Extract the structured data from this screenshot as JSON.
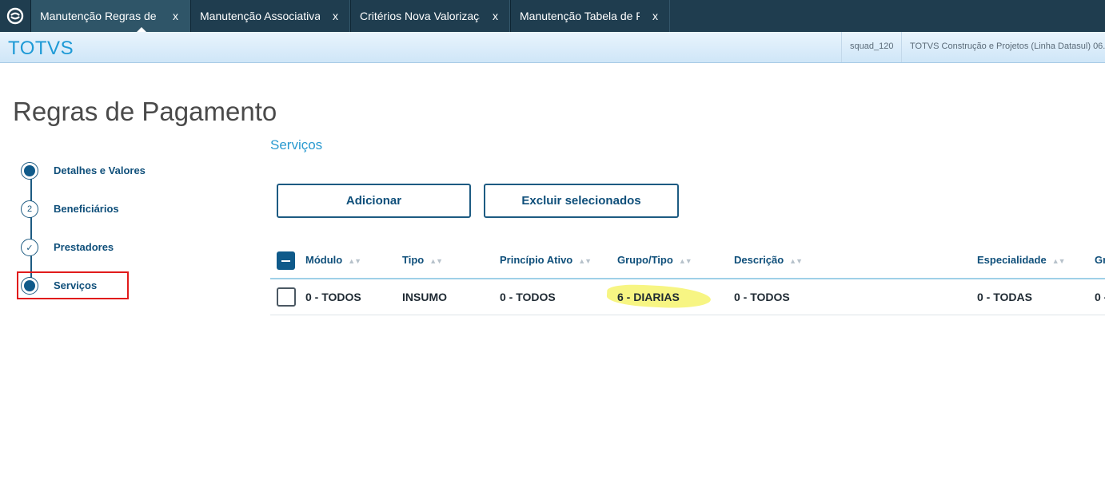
{
  "tabs": [
    {
      "label": "Manutenção Regras de Pagamento",
      "close": "x",
      "active": true
    },
    {
      "label": "Manutenção Associativa",
      "close": "x",
      "active": false
    },
    {
      "label": "Critérios Nova Valorização",
      "close": "x",
      "active": false
    },
    {
      "label": "Manutenção Tabela de Preços",
      "close": "x",
      "active": false
    }
  ],
  "header": {
    "brand": "TOTVS",
    "user": "squad_120",
    "product": "TOTVS Construção e Projetos (Linha Datasul) 06.",
    "gradient_top": "#e9f4fc",
    "gradient_bottom": "#cfe6f8",
    "brand_color": "#1e9ad6"
  },
  "page": {
    "title": "Regras de Pagamento"
  },
  "stepper": {
    "steps": [
      {
        "label": "Detalhes e Valores",
        "state": "current-dot",
        "marker": ""
      },
      {
        "label": "Beneficiários",
        "state": "numbered",
        "marker": "2"
      },
      {
        "label": "Prestadores",
        "state": "done",
        "marker": "✓"
      },
      {
        "label": "Serviços",
        "state": "current-dot",
        "marker": ""
      }
    ],
    "highlighted_step": "Serviços",
    "highlight_color": "#e11b1b"
  },
  "content": {
    "section_title": "Serviços",
    "buttons": {
      "add": "Adicionar",
      "delete_selected": "Excluir selecionados"
    }
  },
  "table": {
    "columns": [
      "Módulo",
      "Tipo",
      "Princípio Ativo",
      "Grupo/Tipo",
      "Descrição",
      "Especialidade",
      "Gr"
    ],
    "rows": [
      [
        "0 - TODOS",
        "INSUMO",
        "0 - TODOS",
        "6 - DIARIAS",
        "0 - TODOS",
        "0 - TODAS",
        "0 -"
      ]
    ],
    "highlighted_cell": "6 - DIARIAS",
    "highlight_color": "#f4f25a"
  },
  "colors": {
    "tabbar": "#1f3d4f",
    "active_tab": "#2f5568",
    "primary": "#0f5a8a",
    "accent": "#2a9ad0"
  },
  "icons": {
    "home": "totvs-logo-icon",
    "sort": "sort-arrows-icon"
  }
}
